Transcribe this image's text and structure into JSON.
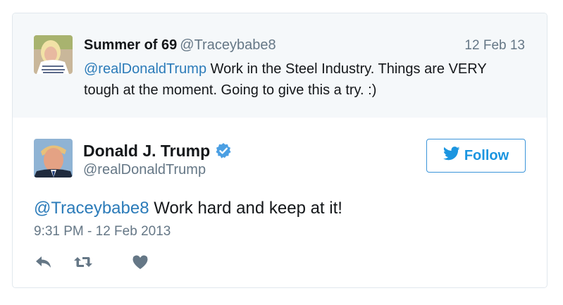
{
  "colors": {
    "link": "#2b7bb9",
    "muted": "#657786",
    "follow_blue": "#1b95e0",
    "verified_blue": "#4b9fe3",
    "quoted_bg": "#f5f8fa"
  },
  "parent_tweet": {
    "display_name": "Summer of 69",
    "handle": "@Traceybabe8",
    "date": "12 Feb 13",
    "mention": "@realDonaldTrump",
    "text": " Work in the Steel Industry. Things are VERY tough at the moment. Going to give this a try. :)"
  },
  "main_tweet": {
    "display_name": "Donald J. Trump",
    "verified_icon": "verified-badge-icon",
    "handle": "@realDonaldTrump",
    "follow_label": "Follow",
    "follow_icon": "twitter-bird-icon",
    "mention": "@Traceybabe8",
    "text": " Work hard and keep at it!",
    "timestamp": "9:31 PM - 12 Feb 2013"
  },
  "actions": {
    "reply_icon": "reply-icon",
    "retweet_icon": "retweet-icon",
    "like_icon": "heart-icon"
  }
}
